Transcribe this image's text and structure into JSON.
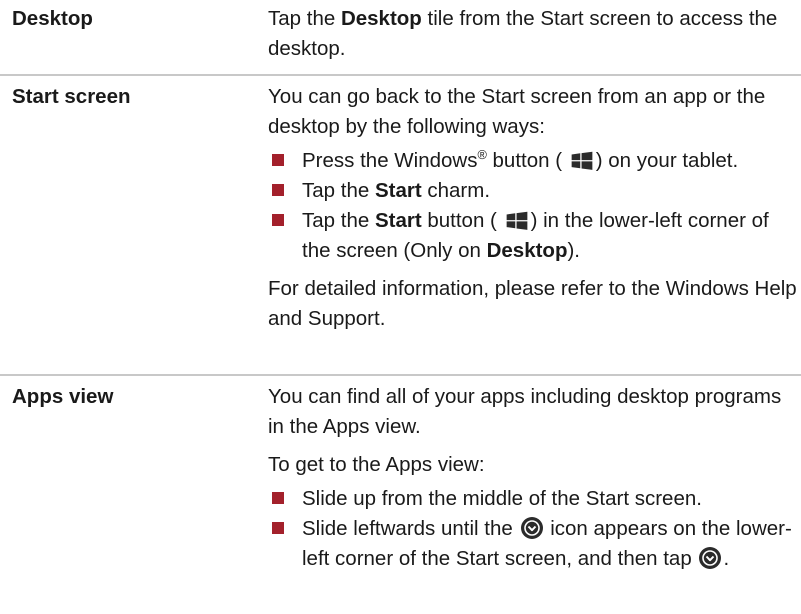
{
  "rows": [
    {
      "term": "Desktop",
      "p1_a": "Tap the ",
      "p1_b": "Desktop",
      "p1_c": " tile from the Start screen to access the desktop."
    },
    {
      "term": "Start screen",
      "intro": "You can go back to the Start screen from an app or the desktop by the following ways:",
      "bullet1_a": "Press the Windows",
      "bullet1_reg": "®",
      "bullet1_b": " button (",
      "bullet1_c": ") on your tablet.",
      "bullet2_a": "Tap the ",
      "bullet2_b": "Start",
      "bullet2_c": " charm.",
      "bullet3_a": "Tap the ",
      "bullet3_b": "Start",
      "bullet3_c": " button (",
      "bullet3_d": ") in the lower-left corner of the screen (Only on ",
      "bullet3_e": "Desktop",
      "bullet3_f": ").",
      "outro": "For detailed information, please refer to the Windows Help and Support."
    },
    {
      "term": "Apps view",
      "intro": "You can find all of your apps including desktop programs in the Apps view.",
      "sub": "To get to the Apps view:",
      "bullet1": "Slide up from the middle of the Start screen.",
      "bullet2_a": "Slide leftwards until the ",
      "bullet2_b": " icon appears on the lower-left corner of the Start screen, and then tap ",
      "bullet2_c": "."
    }
  ],
  "colors": {
    "bullet": "#a3202b",
    "rule": "#c8c8c8",
    "icon": "#2b2b2b"
  },
  "icons": [
    "windows-logo-icon",
    "down-arrow-circle-icon"
  ]
}
